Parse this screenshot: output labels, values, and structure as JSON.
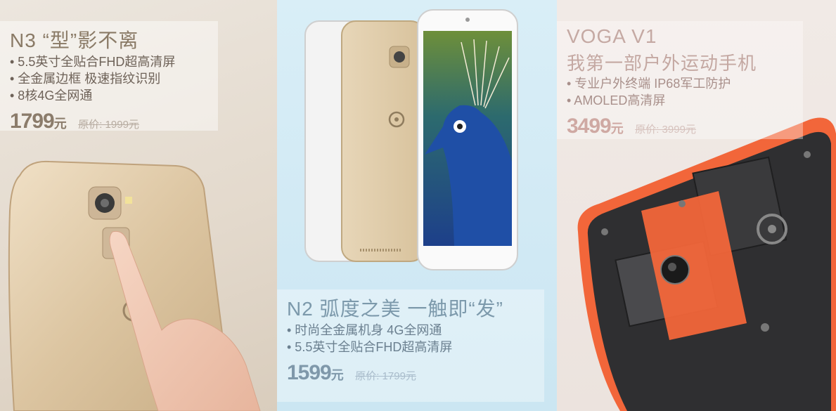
{
  "panels": [
    {
      "title": "N3 “型”影不离",
      "bullets": [
        "• 5.5英寸全贴合FHD超高清屏",
        "• 全金属边框 极速指纹识别",
        "• 8核4G全网通"
      ],
      "price": "1799",
      "unit": "元",
      "original": "原价: 1999元"
    },
    {
      "title": "N2 弧度之美 一触即“发”",
      "bullets": [
        "• 时尚全金属机身 4G全网通",
        "• 5.5英寸全贴合FHD超高清屏"
      ],
      "price": "1599",
      "unit": "元",
      "original": "原价: 1799元"
    },
    {
      "title": "VOGA V1",
      "subtitle": "我第一部户外运动手机",
      "bullets": [
        "• 专业户外终端 IP68军工防护",
        "• AMOLED高清屏"
      ],
      "price": "3499",
      "unit": "元",
      "original": "原价: 3999元"
    }
  ],
  "colors": {
    "panel1_bg": "#e6ddd2",
    "panel2_bg": "#d3eaf5",
    "panel3_bg": "#efe6e1",
    "rugged_orange": "#f2663a",
    "gold_phone": "#d9c2a0"
  },
  "icons": [
    "fingerprint-sensor-icon",
    "brand-logo-icon",
    "camera-icon"
  ]
}
